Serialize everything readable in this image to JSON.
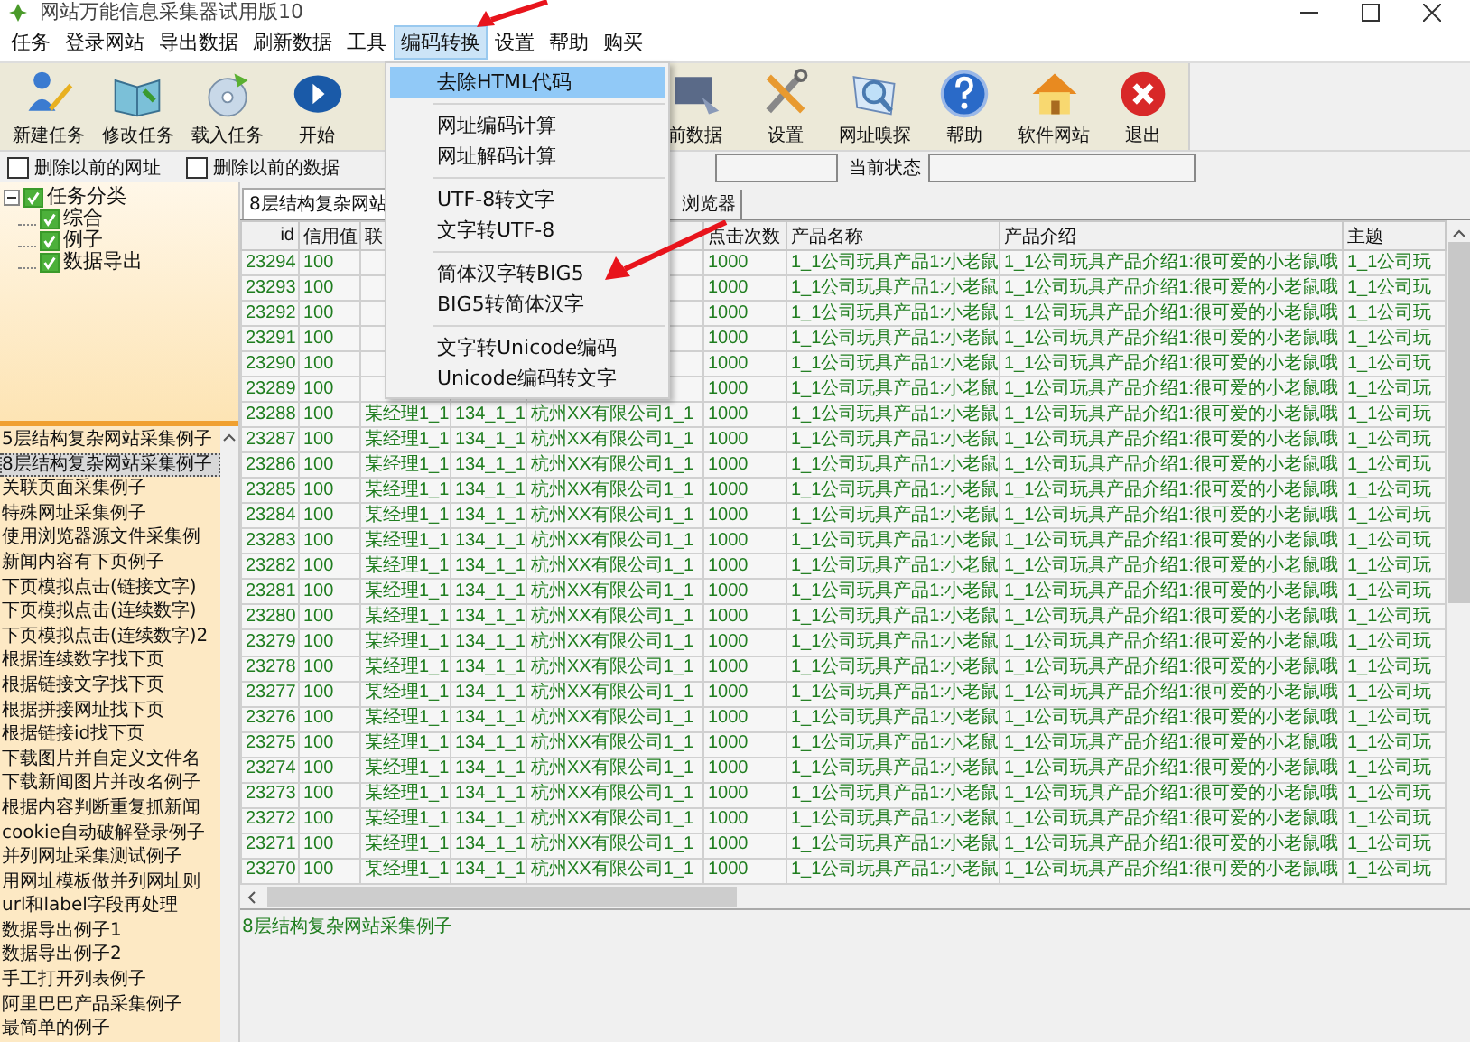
{
  "window": {
    "title": "网站万能信息采集器试用版10"
  },
  "menubar": [
    {
      "label": "任务",
      "selected": false
    },
    {
      "label": "登录网站",
      "selected": false
    },
    {
      "label": "导出数据",
      "selected": false
    },
    {
      "label": "刷新数据",
      "selected": false
    },
    {
      "label": "工具",
      "selected": false
    },
    {
      "label": "编码转换",
      "selected": true
    },
    {
      "label": "设置",
      "selected": false
    },
    {
      "label": "帮助",
      "selected": false
    },
    {
      "label": "购买",
      "selected": false
    }
  ],
  "toolbar": [
    {
      "label": "新建任务"
    },
    {
      "label": "修改任务"
    },
    {
      "label": "载入任务"
    },
    {
      "label": "开始"
    },
    {
      "label": "前数据"
    },
    {
      "label": "设置"
    },
    {
      "label": "网址嗅探"
    },
    {
      "label": "帮助"
    },
    {
      "label": "软件网站"
    },
    {
      "label": "退出"
    }
  ],
  "options": [
    {
      "label": "删除以前的网址",
      "checked": false
    },
    {
      "label": "删除以前的数据",
      "checked": false
    }
  ],
  "status_label": "当前状态",
  "tree": {
    "label": "任务分类",
    "checked": true,
    "expanded": true,
    "children": [
      {
        "label": "综合",
        "checked": true
      },
      {
        "label": "例子",
        "checked": true
      },
      {
        "label": "数据导出",
        "checked": true
      }
    ]
  },
  "task_list": [
    {
      "label": "5层结构复杂网站采集例子",
      "selected": false
    },
    {
      "label": "8层结构复杂网站采集例子",
      "selected": true
    },
    {
      "label": "关联页面采集例子",
      "selected": false
    },
    {
      "label": "特殊网址采集例子",
      "selected": false
    },
    {
      "label": "使用浏览器源文件采集例",
      "selected": false
    },
    {
      "label": "新闻内容有下页例子",
      "selected": false
    },
    {
      "label": "下页模拟点击(链接文字)",
      "selected": false
    },
    {
      "label": "下页模拟点击(连续数字)",
      "selected": false
    },
    {
      "label": "下页模拟点击(连续数字)2",
      "selected": false
    },
    {
      "label": "根据连续数字找下页",
      "selected": false
    },
    {
      "label": "根据链接文字找下页",
      "selected": false
    },
    {
      "label": "根据拼接网址找下页",
      "selected": false
    },
    {
      "label": "根据链接id找下页",
      "selected": false
    },
    {
      "label": "下载图片并自定义文件名",
      "selected": false
    },
    {
      "label": "下载新闻图片并改名例子",
      "selected": false
    },
    {
      "label": "根据内容判断重复抓新闻",
      "selected": false
    },
    {
      "label": "cookie自动破解登录例子",
      "selected": false
    },
    {
      "label": "并列网址采集测试例子",
      "selected": false
    },
    {
      "label": "用网址模板做并列网址则",
      "selected": false
    },
    {
      "label": "url和label字段再处理",
      "selected": false
    },
    {
      "label": "数据导出例子1",
      "selected": false
    },
    {
      "label": "数据导出例子2",
      "selected": false
    },
    {
      "label": "手工打开列表例子",
      "selected": false
    },
    {
      "label": "阿里巴巴产品采集例子",
      "selected": false
    },
    {
      "label": "最简单的例子",
      "selected": false
    }
  ],
  "tabs": [
    {
      "label": "8层结构复杂网站",
      "selected": true
    },
    {
      "label": "浏览器",
      "selected": false
    }
  ],
  "table": {
    "columns": [
      {
        "label": "id"
      },
      {
        "label": "信用值"
      },
      {
        "label": "联"
      },
      {},
      {},
      {
        "label": "点击次数"
      },
      {
        "label": "产品名称"
      },
      {
        "label": "产品介绍"
      },
      {
        "label": "主题"
      }
    ],
    "rows": [
      [
        "23294",
        "100",
        null,
        null,
        null,
        "1000",
        "1_1公司玩具产品1:小老鼠",
        "1_1公司玩具产品介绍1:很可爱的小老鼠哦",
        "1_1公司玩"
      ],
      [
        "23293",
        "100",
        null,
        null,
        null,
        "1000",
        "1_1公司玩具产品1:小老鼠",
        "1_1公司玩具产品介绍1:很可爱的小老鼠哦",
        "1_1公司玩"
      ],
      [
        "23292",
        "100",
        null,
        null,
        null,
        "1000",
        "1_1公司玩具产品1:小老鼠",
        "1_1公司玩具产品介绍1:很可爱的小老鼠哦",
        "1_1公司玩"
      ],
      [
        "23291",
        "100",
        null,
        null,
        null,
        "1000",
        "1_1公司玩具产品1:小老鼠",
        "1_1公司玩具产品介绍1:很可爱的小老鼠哦",
        "1_1公司玩"
      ],
      [
        "23290",
        "100",
        null,
        null,
        null,
        "1000",
        "1_1公司玩具产品1:小老鼠",
        "1_1公司玩具产品介绍1:很可爱的小老鼠哦",
        "1_1公司玩"
      ],
      [
        "23289",
        "100",
        null,
        null,
        null,
        "1000",
        "1_1公司玩具产品1:小老鼠",
        "1_1公司玩具产品介绍1:很可爱的小老鼠哦",
        "1_1公司玩"
      ],
      [
        "23288",
        "100",
        "某经理1_1",
        "134_1_1",
        "杭州XX有限公司1_1",
        "1000",
        "1_1公司玩具产品1:小老鼠",
        "1_1公司玩具产品介绍1:很可爱的小老鼠哦",
        "1_1公司玩"
      ],
      [
        "23287",
        "100",
        "某经理1_1",
        "134_1_1",
        "杭州XX有限公司1_1",
        "1000",
        "1_1公司玩具产品1:小老鼠",
        "1_1公司玩具产品介绍1:很可爱的小老鼠哦",
        "1_1公司玩"
      ],
      [
        "23286",
        "100",
        "某经理1_1",
        "134_1_1",
        "杭州XX有限公司1_1",
        "1000",
        "1_1公司玩具产品1:小老鼠",
        "1_1公司玩具产品介绍1:很可爱的小老鼠哦",
        "1_1公司玩"
      ],
      [
        "23285",
        "100",
        "某经理1_1",
        "134_1_1",
        "杭州XX有限公司1_1",
        "1000",
        "1_1公司玩具产品1:小老鼠",
        "1_1公司玩具产品介绍1:很可爱的小老鼠哦",
        "1_1公司玩"
      ],
      [
        "23284",
        "100",
        "某经理1_1",
        "134_1_1",
        "杭州XX有限公司1_1",
        "1000",
        "1_1公司玩具产品1:小老鼠",
        "1_1公司玩具产品介绍1:很可爱的小老鼠哦",
        "1_1公司玩"
      ],
      [
        "23283",
        "100",
        "某经理1_1",
        "134_1_1",
        "杭州XX有限公司1_1",
        "1000",
        "1_1公司玩具产品1:小老鼠",
        "1_1公司玩具产品介绍1:很可爱的小老鼠哦",
        "1_1公司玩"
      ],
      [
        "23282",
        "100",
        "某经理1_1",
        "134_1_1",
        "杭州XX有限公司1_1",
        "1000",
        "1_1公司玩具产品1:小老鼠",
        "1_1公司玩具产品介绍1:很可爱的小老鼠哦",
        "1_1公司玩"
      ],
      [
        "23281",
        "100",
        "某经理1_1",
        "134_1_1",
        "杭州XX有限公司1_1",
        "1000",
        "1_1公司玩具产品1:小老鼠",
        "1_1公司玩具产品介绍1:很可爱的小老鼠哦",
        "1_1公司玩"
      ],
      [
        "23280",
        "100",
        "某经理1_1",
        "134_1_1",
        "杭州XX有限公司1_1",
        "1000",
        "1_1公司玩具产品1:小老鼠",
        "1_1公司玩具产品介绍1:很可爱的小老鼠哦",
        "1_1公司玩"
      ],
      [
        "23279",
        "100",
        "某经理1_1",
        "134_1_1",
        "杭州XX有限公司1_1",
        "1000",
        "1_1公司玩具产品1:小老鼠",
        "1_1公司玩具产品介绍1:很可爱的小老鼠哦",
        "1_1公司玩"
      ],
      [
        "23278",
        "100",
        "某经理1_1",
        "134_1_1",
        "杭州XX有限公司1_1",
        "1000",
        "1_1公司玩具产品1:小老鼠",
        "1_1公司玩具产品介绍1:很可爱的小老鼠哦",
        "1_1公司玩"
      ],
      [
        "23277",
        "100",
        "某经理1_1",
        "134_1_1",
        "杭州XX有限公司1_1",
        "1000",
        "1_1公司玩具产品1:小老鼠",
        "1_1公司玩具产品介绍1:很可爱的小老鼠哦",
        "1_1公司玩"
      ],
      [
        "23276",
        "100",
        "某经理1_1",
        "134_1_1",
        "杭州XX有限公司1_1",
        "1000",
        "1_1公司玩具产品1:小老鼠",
        "1_1公司玩具产品介绍1:很可爱的小老鼠哦",
        "1_1公司玩"
      ],
      [
        "23275",
        "100",
        "某经理1_1",
        "134_1_1",
        "杭州XX有限公司1_1",
        "1000",
        "1_1公司玩具产品1:小老鼠",
        "1_1公司玩具产品介绍1:很可爱的小老鼠哦",
        "1_1公司玩"
      ],
      [
        "23274",
        "100",
        "某经理1_1",
        "134_1_1",
        "杭州XX有限公司1_1",
        "1000",
        "1_1公司玩具产品1:小老鼠",
        "1_1公司玩具产品介绍1:很可爱的小老鼠哦",
        "1_1公司玩"
      ],
      [
        "23273",
        "100",
        "某经理1_1",
        "134_1_1",
        "杭州XX有限公司1_1",
        "1000",
        "1_1公司玩具产品1:小老鼠",
        "1_1公司玩具产品介绍1:很可爱的小老鼠哦",
        "1_1公司玩"
      ],
      [
        "23272",
        "100",
        "某经理1_1",
        "134_1_1",
        "杭州XX有限公司1_1",
        "1000",
        "1_1公司玩具产品1:小老鼠",
        "1_1公司玩具产品介绍1:很可爱的小老鼠哦",
        "1_1公司玩"
      ],
      [
        "23271",
        "100",
        "某经理1_1",
        "134_1_1",
        "杭州XX有限公司1_1",
        "1000",
        "1_1公司玩具产品1:小老鼠",
        "1_1公司玩具产品介绍1:很可爱的小老鼠哦",
        "1_1公司玩"
      ],
      [
        "23270",
        "100",
        "某经理1_1",
        "134_1_1",
        "杭州XX有限公司1_1",
        "1000",
        "1_1公司玩具产品1:小老鼠",
        "1_1公司玩具产品介绍1:很可爱的小老鼠哦",
        "1_1公司玩"
      ]
    ]
  },
  "status_bar": "8层结构复杂网站采集例子",
  "dropdown_menu": [
    {
      "label": "去除HTML代码",
      "highlighted": true,
      "separator_after": true
    },
    {
      "label": "网址编码计算",
      "highlighted": false,
      "separator_after": false
    },
    {
      "label": "网址解码计算",
      "highlighted": false,
      "separator_after": true
    },
    {
      "label": "UTF-8转文字",
      "highlighted": false,
      "separator_after": false
    },
    {
      "label": "文字转UTF-8",
      "highlighted": false,
      "separator_after": true
    },
    {
      "label": "简体汉字转BIG5",
      "highlighted": false,
      "separator_after": false
    },
    {
      "label": "BIG5转简体汉字",
      "highlighted": false,
      "separator_after": true
    },
    {
      "label": "文字转Unicode编码",
      "highlighted": false,
      "separator_after": false
    },
    {
      "label": "Unicode编码转文字",
      "highlighted": false,
      "separator_after": false
    }
  ]
}
